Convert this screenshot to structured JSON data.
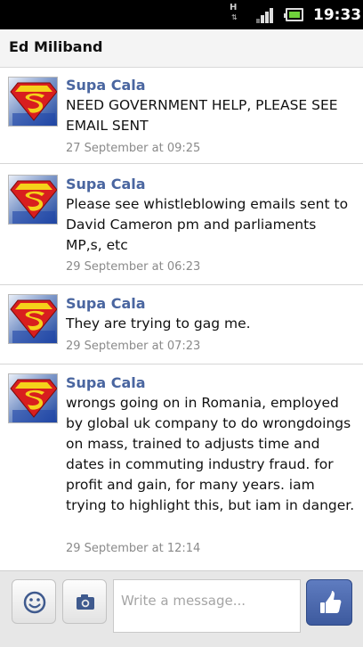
{
  "status_bar": {
    "network_icon": "h-network-icon",
    "signal_icon": "signal-strength-icon",
    "battery_icon": "battery-icon",
    "time": "19:33"
  },
  "header": {
    "title": "Ed Miliband"
  },
  "messages": [
    {
      "sender": "Supa Cala",
      "text": "NEED GOVERNMENT HELP, PLEASE SEE EMAIL SENT",
      "time": "27 September at 09:25",
      "avatar_icon": "superman-logo-icon"
    },
    {
      "sender": "Supa Cala",
      "text": "Please see whistleblowing emails sent to David Cameron pm and parliaments MP,s, etc",
      "time": "29 September at 06:23",
      "avatar_icon": "superman-logo-icon"
    },
    {
      "sender": "Supa Cala",
      "text": "They are trying to gag me.",
      "time": "29 September at 07:23",
      "avatar_icon": "superman-logo-icon"
    },
    {
      "sender": "Supa Cala",
      "text": "wrongs going on in Romania, employed by global uk company to do wrongdoings on mass, trained to adjusts time and dates in commuting industry fraud. for profit and gain, for many years. iam trying to highlight this, but iam in danger.",
      "time": "29 September at 12:14",
      "avatar_icon": "superman-logo-icon"
    }
  ],
  "composer": {
    "emoji_icon": "smiley-icon",
    "camera_icon": "camera-icon",
    "placeholder": "Write a message...",
    "like_icon": "thumbs-up-icon"
  },
  "colors": {
    "sender_name": "#4a66a0",
    "like_button": "#4b68ad",
    "timestamp": "#8a8a8a"
  }
}
